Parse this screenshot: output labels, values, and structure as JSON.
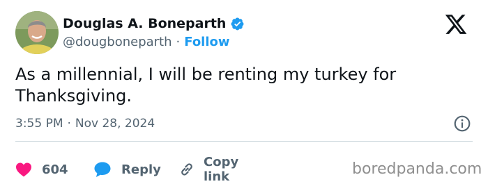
{
  "author": {
    "display_name": "Douglas A. Boneparth",
    "handle": "@dougboneparth",
    "separator": "·",
    "follow_label": "Follow",
    "verified": true
  },
  "tweet": {
    "text": "As a millennial, I will be renting my turkey for Thanksgiving.",
    "time": "3:55 PM",
    "separator": "·",
    "date": "Nov 28, 2024"
  },
  "actions": {
    "like_count": "604",
    "reply_label": "Reply",
    "copy_label": "Copy link"
  },
  "watermark": "boredpanda.com",
  "colors": {
    "accent": "#1d9bf0",
    "like": "#f91880",
    "text": "#0f1419",
    "muted": "#536471"
  },
  "icons": {
    "logo": "x-logo-icon",
    "verified": "verified-badge-icon",
    "info": "info-icon",
    "like": "heart-icon",
    "reply": "reply-bubble-icon",
    "copy": "link-icon"
  }
}
